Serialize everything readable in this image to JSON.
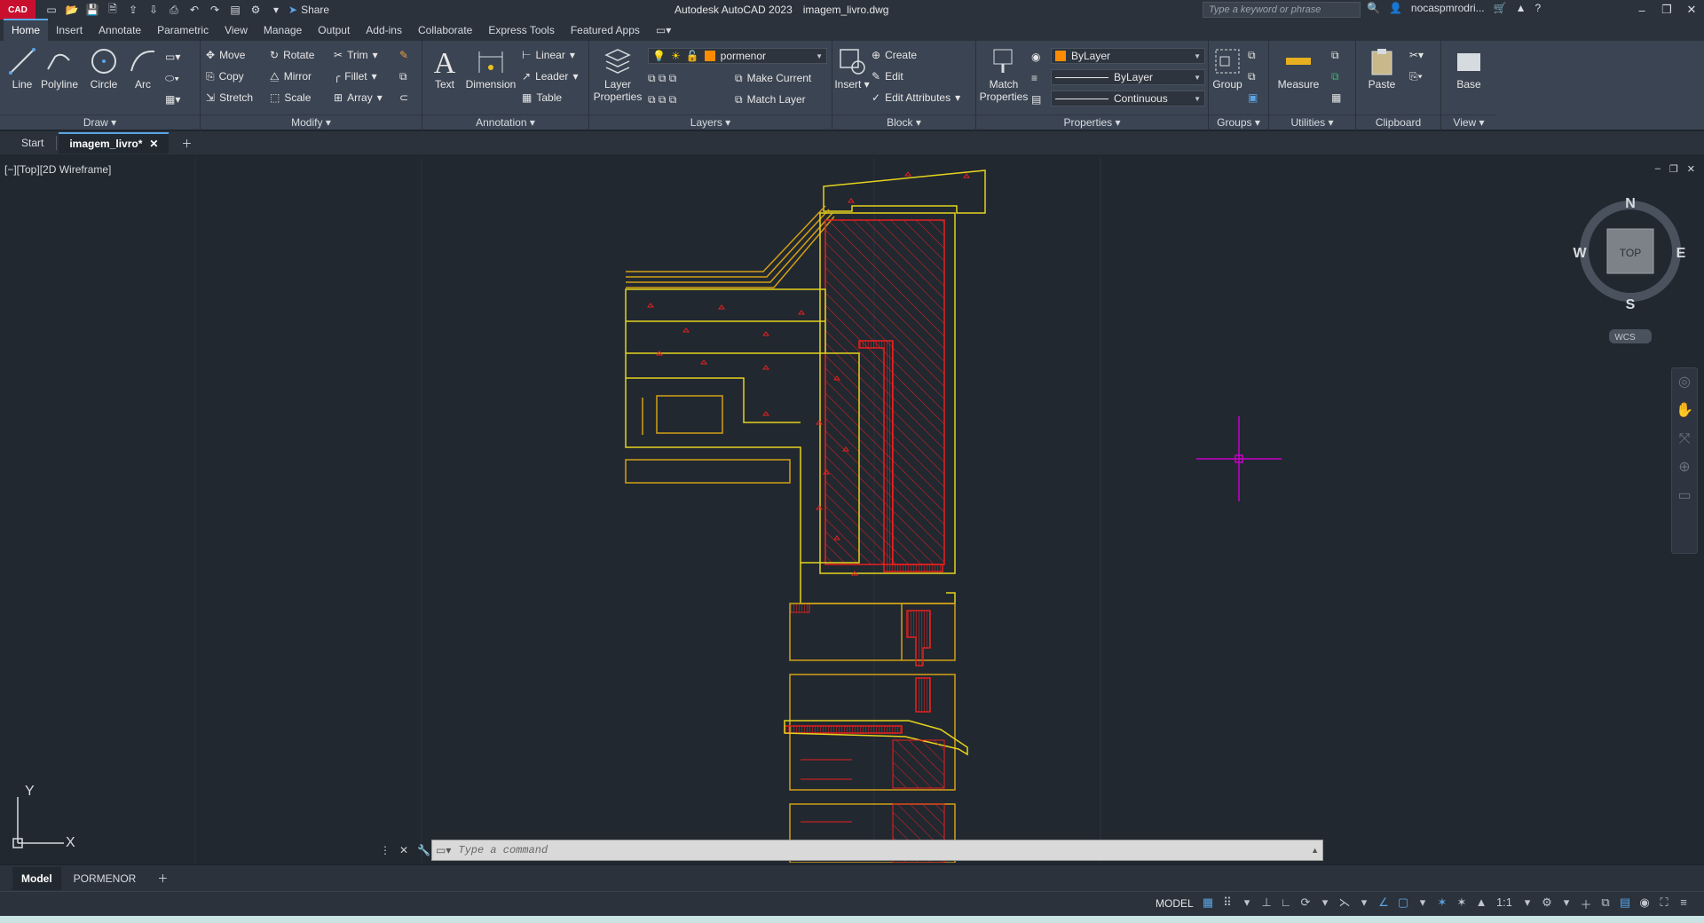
{
  "app": {
    "logo": "CAD",
    "title": "Autodesk AutoCAD 2023",
    "file": "imagem_livro.dwg",
    "share_label": "Share"
  },
  "search": {
    "placeholder": "Type a keyword or phrase"
  },
  "user": {
    "name": "nocaspmrodri..."
  },
  "ribbon_tabs": [
    "Home",
    "Insert",
    "Annotate",
    "Parametric",
    "View",
    "Manage",
    "Output",
    "Add-ins",
    "Collaborate",
    "Express Tools",
    "Featured Apps"
  ],
  "draw": {
    "line": "Line",
    "polyline": "Polyline",
    "circle": "Circle",
    "arc": "Arc",
    "panel": "Draw"
  },
  "modify": {
    "move": "Move",
    "rotate": "Rotate",
    "trim": "Trim",
    "copy": "Copy",
    "mirror": "Mirror",
    "fillet": "Fillet",
    "stretch": "Stretch",
    "scale": "Scale",
    "array": "Array",
    "panel": "Modify"
  },
  "annotation": {
    "text": "Text",
    "dimension": "Dimension",
    "linear": "Linear",
    "leader": "Leader",
    "table": "Table",
    "panel": "Annotation"
  },
  "layers": {
    "layer_properties": "Layer Properties",
    "current_layer": "pormenor",
    "make_current": "Make Current",
    "match_layer": "Match Layer",
    "panel": "Layers"
  },
  "block": {
    "insert": "Insert",
    "create": "Create",
    "edit": "Edit",
    "edit_attributes": "Edit Attributes",
    "panel": "Block"
  },
  "properties": {
    "match": "Match Properties",
    "color": "ByLayer",
    "lineweight": "ByLayer",
    "linetype": "Continuous",
    "panel": "Properties"
  },
  "groups": {
    "group": "Group",
    "panel": "Groups"
  },
  "utilities": {
    "measure": "Measure",
    "panel": "Utilities"
  },
  "clipboard": {
    "paste": "Paste",
    "panel": "Clipboard"
  },
  "view_panel": {
    "base": "Base",
    "panel": "View"
  },
  "file_tabs": {
    "start": "Start",
    "current": "imagem_livro*"
  },
  "viewport": {
    "label": "[−][Top][2D Wireframe]"
  },
  "viewcube": {
    "n": "N",
    "s": "S",
    "e": "E",
    "w": "W",
    "top": "TOP",
    "wcs": "WCS"
  },
  "ucs": {
    "x": "X",
    "y": "Y"
  },
  "command": {
    "placeholder": "Type  a  command"
  },
  "layout_tabs": [
    "Model",
    "PORMENOR"
  ],
  "status": {
    "model": "MODEL",
    "scale": "1:1"
  },
  "colors": {
    "accent": "#5aa5e6",
    "drawing_yellow": "#e6d21e",
    "drawing_red": "#e8201e",
    "drawing_orange": "#d4a017",
    "crosshair": "#c800c8",
    "layer_swatch": "#ff8c00"
  }
}
